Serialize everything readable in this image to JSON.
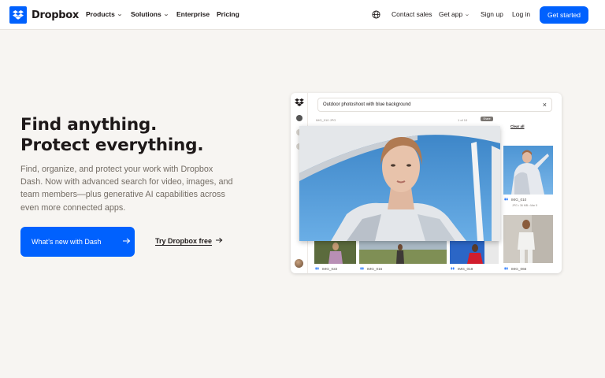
{
  "nav": {
    "brand": "Dropbox",
    "products": "Products",
    "solutions": "Solutions",
    "enterprise": "Enterprise",
    "pricing": "Pricing",
    "contact_sales": "Contact sales",
    "get_app": "Get app",
    "sign_up": "Sign up",
    "log_in": "Log in",
    "get_started": "Get started"
  },
  "hero": {
    "headline_1": "Find anything.",
    "headline_2": "Protect everything.",
    "subtitle": "Find, organize, and protect your work with Dropbox Dash. Now with advanced search for video, images, and team members—plus generative AI capabilities across even more connected apps.",
    "primary_button": "What’s new with Dash",
    "secondary_link": "Try Dropbox free"
  },
  "app": {
    "search_query": "Outdoor photoshoot with blue background",
    "toolbar_text": "IMG_010   JPG",
    "toolbar_right": "1 of 10",
    "share": "Share",
    "clear_all": "Clear all",
    "results": [
      {
        "label": "IMG_010",
        "meta": "JPG • 36 MB • Mar 5"
      },
      {
        "label": "IMG_022"
      },
      {
        "label": "IMG_016"
      },
      {
        "label": "IMG_018"
      },
      {
        "label": "IMG_066"
      }
    ]
  },
  "colors": {
    "accent": "#0061fe",
    "background": "#f7f5f2",
    "text": "#1e1919",
    "muted": "#736c64"
  }
}
